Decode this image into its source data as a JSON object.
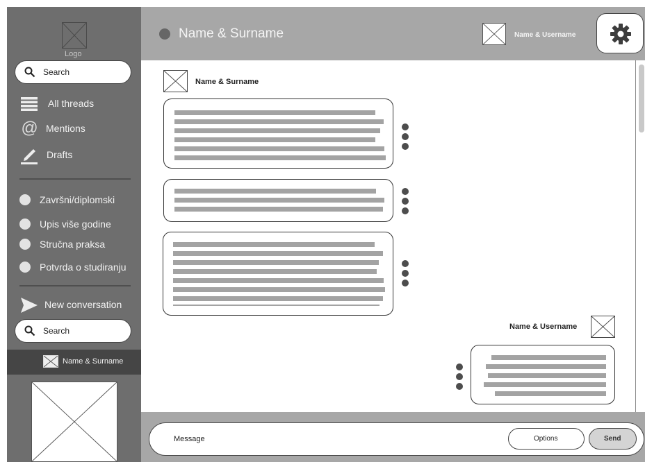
{
  "sidebar": {
    "logo_label": "Logo",
    "search_top": {
      "placeholder": "Search"
    },
    "nav": [
      {
        "label": "All threads",
        "icon": "list-icon"
      },
      {
        "label": "Mentions",
        "icon": "at-icon"
      },
      {
        "label": "Drafts",
        "icon": "pencil-icon"
      }
    ],
    "channels": [
      {
        "label": "Završni/diplomski"
      },
      {
        "label": "Upis više godine"
      },
      {
        "label": "Stručna praksa"
      },
      {
        "label": "Potvrda o studiranju"
      }
    ],
    "new_conversation_label": "New conversation",
    "search_bottom": {
      "placeholder": "Search"
    },
    "selected_contact": {
      "name": "Name & Surname"
    }
  },
  "header": {
    "title": "Name & Surname",
    "user_label": "Name & Username",
    "settings_icon": "gear-icon"
  },
  "chat": {
    "incoming_name": "Name & Surname",
    "outgoing_name": "Name & Username"
  },
  "composer": {
    "placeholder": "Message",
    "options_label": "Options",
    "send_label": "Send"
  },
  "colors": {
    "sidebar_bg": "#6e6e6e",
    "header_bg": "#a7a7a7",
    "selected_row_bg": "#454545",
    "text_line": "#a3a3a3"
  }
}
